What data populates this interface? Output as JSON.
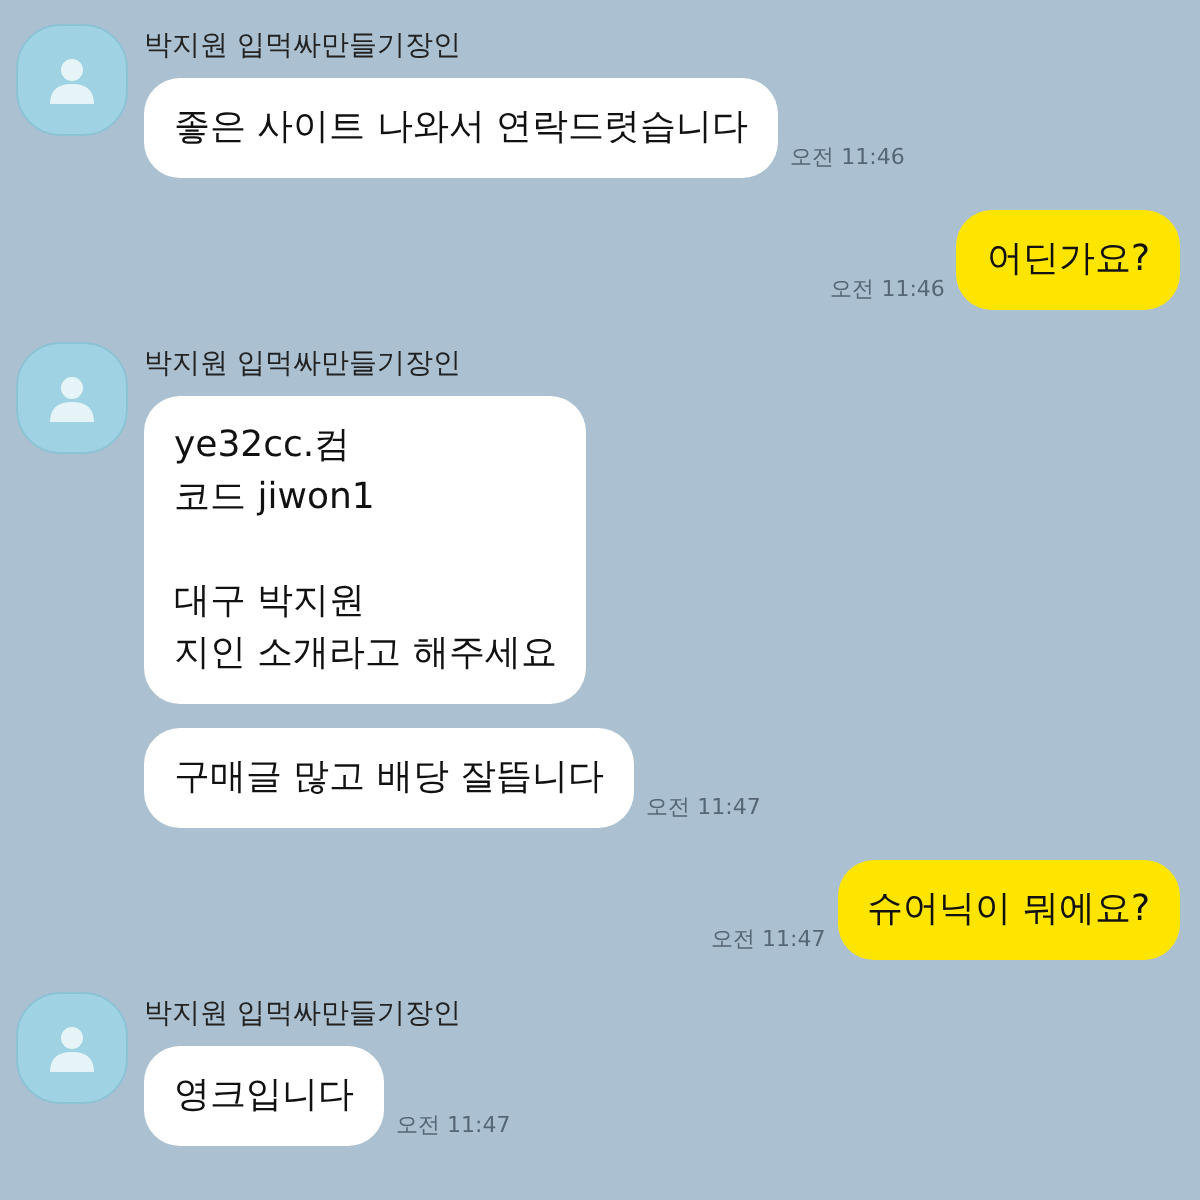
{
  "messages": [
    {
      "kind": "received",
      "sender": "박지원 입먹싸만들기장인",
      "bubbles": [
        {
          "text": "좋은 사이트 나와서 연락드렷습니다",
          "time": "오전 11:46"
        }
      ]
    },
    {
      "kind": "sent",
      "bubbles": [
        {
          "text": "어딘가요?",
          "time": "오전 11:46"
        }
      ]
    },
    {
      "kind": "received",
      "sender": "박지원 입먹싸만들기장인",
      "bubbles": [
        {
          "text": "ye32cc.컴\n코드 jiwon1\n\n대구 박지원\n지인 소개라고 해주세요"
        },
        {
          "text": "구매글 많고 배당 잘뜹니다",
          "time": "오전 11:47"
        }
      ]
    },
    {
      "kind": "sent",
      "bubbles": [
        {
          "text": "슈어닉이 뭐에요?",
          "time": "오전 11:47"
        }
      ]
    },
    {
      "kind": "received",
      "sender": "박지원 입먹싸만들기장인",
      "bubbles": [
        {
          "text": "영크입니다",
          "time": "오전 11:47"
        }
      ]
    }
  ]
}
